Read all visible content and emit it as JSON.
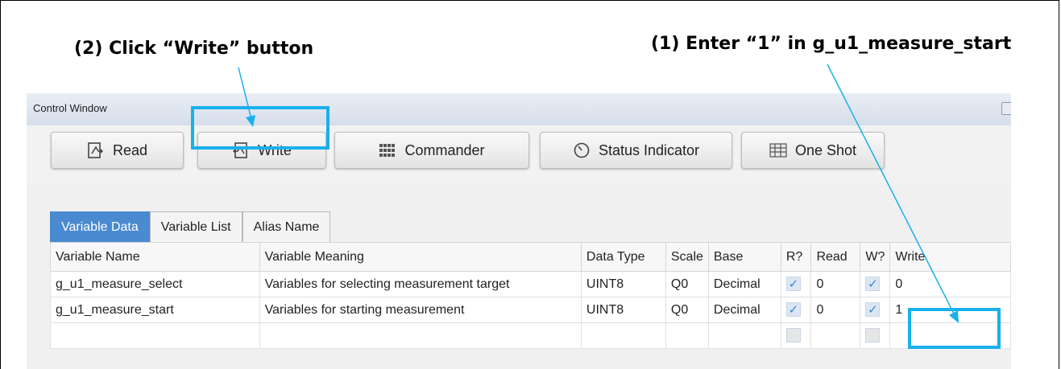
{
  "annotations": {
    "left": "(2) Click “Write” button",
    "right": "(1) Enter “1” in g_u1_measure_start",
    "highlight_color": "#1ab0ea"
  },
  "window": {
    "title": "Control Window"
  },
  "toolbar": {
    "read": "Read",
    "write": "Write",
    "commander": "Commander",
    "status_indicator": "Status Indicator",
    "one_shot": "One Shot"
  },
  "tabs": [
    "Variable Data",
    "Variable List",
    "Alias Name"
  ],
  "active_tab": "Variable Data",
  "table": {
    "headers": [
      "Variable Name",
      "Variable Meaning",
      "Data Type",
      "Scale",
      "Base",
      "R?",
      "Read",
      "W?",
      "Write"
    ],
    "rows": [
      {
        "name": "g_u1_measure_select",
        "meaning": "Variables for selecting measurement target",
        "type": "UINT8",
        "scale": "Q0",
        "base": "Decimal",
        "read": "0",
        "write": "0"
      },
      {
        "name": "g_u1_measure_start",
        "meaning": "Variables for starting measurement",
        "type": "UINT8",
        "scale": "Q0",
        "base": "Decimal",
        "read": "0",
        "write": "1"
      }
    ]
  },
  "icons": [
    "read-icon",
    "write-icon",
    "commander-icon",
    "status-indicator-icon",
    "one-shot-icon",
    "checkbox-checked-icon"
  ]
}
